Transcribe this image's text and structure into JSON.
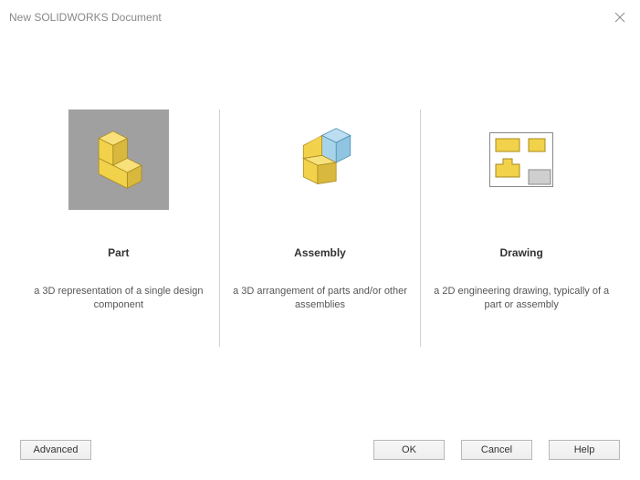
{
  "window": {
    "title": "New SOLIDWORKS Document"
  },
  "options": {
    "part": {
      "title": "Part",
      "description": "a 3D representation of a single design component"
    },
    "assembly": {
      "title": "Assembly",
      "description": "a 3D arrangement of parts and/or other assemblies"
    },
    "drawing": {
      "title": "Drawing",
      "description": "a 2D engineering drawing, typically of a part or assembly"
    }
  },
  "buttons": {
    "advanced": "Advanced",
    "ok": "OK",
    "cancel": "Cancel",
    "help": "Help"
  }
}
